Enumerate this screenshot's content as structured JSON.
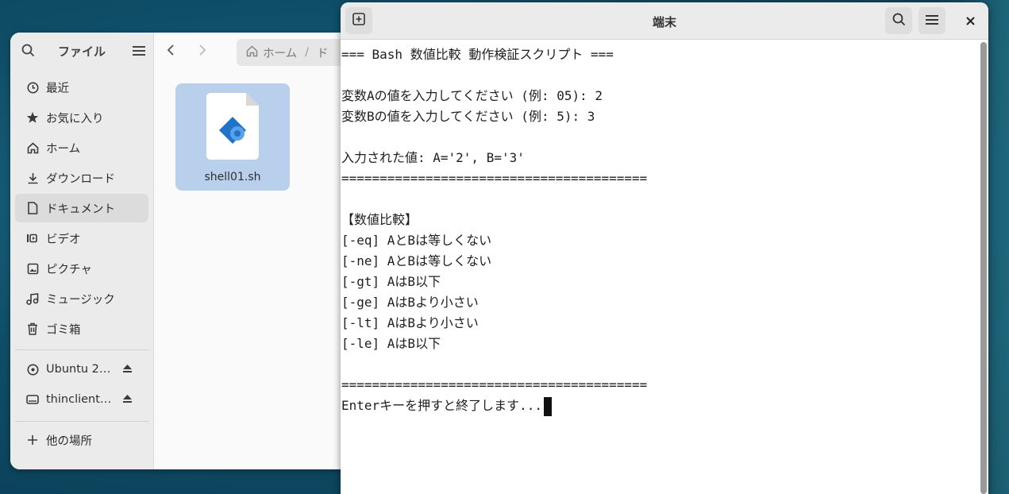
{
  "files": {
    "sidebar_title": "ファイル",
    "places": [
      {
        "label": "最近",
        "icon": "clock-icon"
      },
      {
        "label": "お気に入り",
        "icon": "star-icon"
      },
      {
        "label": "ホーム",
        "icon": "home-icon"
      },
      {
        "label": "ダウンロード",
        "icon": "download-icon"
      },
      {
        "label": "ドキュメント",
        "icon": "document-icon",
        "active": true
      },
      {
        "label": "ビデオ",
        "icon": "video-icon"
      },
      {
        "label": "ピクチャ",
        "icon": "picture-icon"
      },
      {
        "label": "ミュージック",
        "icon": "music-icon"
      },
      {
        "label": "ゴミ箱",
        "icon": "trash-icon"
      }
    ],
    "devices": [
      {
        "label": "Ubuntu 2…",
        "icon": "disc-icon"
      },
      {
        "label": "thinclient…",
        "icon": "drive-icon"
      }
    ],
    "other_places": "他の場所",
    "path": [
      "ホーム",
      "ド"
    ],
    "file": {
      "name": "shell01.sh"
    }
  },
  "terminal": {
    "title": "端末",
    "lines": [
      "=== Bash 数値比較 動作検証スクリプト ===",
      "",
      "変数Aの値を入力してください (例: 05): 2",
      "変数Bの値を入力してください (例: 5): 3",
      "",
      "入力された値: A='2', B='3'",
      "========================================",
      "",
      "【数値比較】",
      "[-eq] AとBは等しくない",
      "[-ne] AとBは等しくない",
      "[-gt] AはB以下",
      "[-ge] AはBより小さい",
      "[-lt] AはBより小さい",
      "[-le] AはB以下",
      "",
      "========================================",
      "Enterキーを押すと終了します..."
    ]
  }
}
